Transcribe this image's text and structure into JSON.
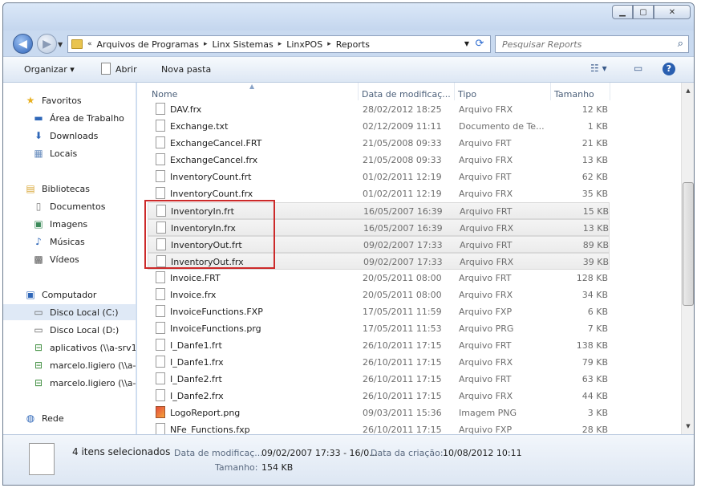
{
  "window": {
    "min_label": "▁",
    "max_label": "▢",
    "close_label": "✕"
  },
  "address": {
    "crumbs": [
      "Arquivos de Programas",
      "Linx Sistemas",
      "LinxPOS",
      "Reports"
    ],
    "prefix": "«",
    "separator": "▸",
    "search_placeholder": "Pesquisar Reports"
  },
  "toolbar": {
    "organize": "Organizar ▾",
    "open": "Abrir",
    "new_folder": "Nova pasta"
  },
  "sidebar": {
    "items": [
      {
        "label": "Favoritos",
        "icon": "star-icon",
        "indent": 0,
        "selected": false
      },
      {
        "label": "Área de Trabalho",
        "icon": "desktop-icon",
        "indent": 1,
        "selected": false
      },
      {
        "label": "Downloads",
        "icon": "downloads-icon",
        "indent": 1,
        "selected": false
      },
      {
        "label": "Locais",
        "icon": "places-icon",
        "indent": 1,
        "selected": false
      },
      {
        "label": "Bibliotecas",
        "icon": "library-icon",
        "indent": 0,
        "selected": false
      },
      {
        "label": "Documentos",
        "icon": "documents-icon",
        "indent": 1,
        "selected": false
      },
      {
        "label": "Imagens",
        "icon": "pictures-icon",
        "indent": 1,
        "selected": false
      },
      {
        "label": "Músicas",
        "icon": "music-icon",
        "indent": 1,
        "selected": false
      },
      {
        "label": "Vídeos",
        "icon": "video-icon",
        "indent": 1,
        "selected": false
      },
      {
        "label": "Computador",
        "icon": "computer-icon",
        "indent": 0,
        "selected": false
      },
      {
        "label": "Disco Local (C:)",
        "icon": "drive-icon",
        "indent": 1,
        "selected": true
      },
      {
        "label": "Disco Local (D:)",
        "icon": "drive-icon",
        "indent": 1,
        "selected": false
      },
      {
        "label": "aplicativos (\\\\a-srv1-",
        "icon": "network-drive-icon",
        "indent": 1,
        "selected": false
      },
      {
        "label": "marcelo.ligiero (\\\\a-",
        "icon": "network-drive-icon",
        "indent": 1,
        "selected": false
      },
      {
        "label": "marcelo.ligiero (\\\\a-",
        "icon": "network-drive-icon",
        "indent": 1,
        "selected": false
      },
      {
        "label": "Rede",
        "icon": "network-icon",
        "indent": 0,
        "selected": false
      }
    ]
  },
  "columns": {
    "name": "Nome",
    "date": "Data de modificaç...",
    "type": "Tipo",
    "size": "Tamanho"
  },
  "files": [
    {
      "name": "DAV.frx",
      "date": "28/02/2012 18:25",
      "type": "Arquivo FRX",
      "size": "12 KB",
      "selected": false,
      "icon": "file-icon"
    },
    {
      "name": "Exchange.txt",
      "date": "02/12/2009 11:11",
      "type": "Documento de Te...",
      "size": "1 KB",
      "selected": false,
      "icon": "text-file-icon"
    },
    {
      "name": "ExchangeCancel.FRT",
      "date": "21/05/2008 09:33",
      "type": "Arquivo FRT",
      "size": "21 KB",
      "selected": false,
      "icon": "file-icon"
    },
    {
      "name": "ExchangeCancel.frx",
      "date": "21/05/2008 09:33",
      "type": "Arquivo FRX",
      "size": "13 KB",
      "selected": false,
      "icon": "file-icon"
    },
    {
      "name": "InventoryCount.frt",
      "date": "01/02/2011 12:19",
      "type": "Arquivo FRT",
      "size": "62 KB",
      "selected": false,
      "icon": "file-icon"
    },
    {
      "name": "InventoryCount.frx",
      "date": "01/02/2011 12:19",
      "type": "Arquivo FRX",
      "size": "35 KB",
      "selected": false,
      "icon": "file-icon"
    },
    {
      "name": "InventoryIn.frt",
      "date": "16/05/2007 16:39",
      "type": "Arquivo FRT",
      "size": "15 KB",
      "selected": true,
      "icon": "file-icon"
    },
    {
      "name": "InventoryIn.frx",
      "date": "16/05/2007 16:39",
      "type": "Arquivo FRX",
      "size": "13 KB",
      "selected": true,
      "icon": "file-icon"
    },
    {
      "name": "InventoryOut.frt",
      "date": "09/02/2007 17:33",
      "type": "Arquivo FRT",
      "size": "89 KB",
      "selected": true,
      "icon": "file-icon"
    },
    {
      "name": "InventoryOut.frx",
      "date": "09/02/2007 17:33",
      "type": "Arquivo FRX",
      "size": "39 KB",
      "selected": true,
      "icon": "file-icon"
    },
    {
      "name": "Invoice.FRT",
      "date": "20/05/2011 08:00",
      "type": "Arquivo FRT",
      "size": "128 KB",
      "selected": false,
      "icon": "file-icon"
    },
    {
      "name": "Invoice.frx",
      "date": "20/05/2011 08:00",
      "type": "Arquivo FRX",
      "size": "34 KB",
      "selected": false,
      "icon": "file-icon"
    },
    {
      "name": "InvoiceFunctions.FXP",
      "date": "17/05/2011 11:59",
      "type": "Arquivo FXP",
      "size": "6 KB",
      "selected": false,
      "icon": "file-icon"
    },
    {
      "name": "InvoiceFunctions.prg",
      "date": "17/05/2011 11:53",
      "type": "Arquivo PRG",
      "size": "7 KB",
      "selected": false,
      "icon": "file-icon"
    },
    {
      "name": "I_Danfe1.frt",
      "date": "26/10/2011 17:15",
      "type": "Arquivo FRT",
      "size": "138 KB",
      "selected": false,
      "icon": "file-icon"
    },
    {
      "name": "I_Danfe1.frx",
      "date": "26/10/2011 17:15",
      "type": "Arquivo FRX",
      "size": "79 KB",
      "selected": false,
      "icon": "file-icon"
    },
    {
      "name": "I_Danfe2.frt",
      "date": "26/10/2011 17:15",
      "type": "Arquivo FRT",
      "size": "63 KB",
      "selected": false,
      "icon": "file-icon"
    },
    {
      "name": "I_Danfe2.frx",
      "date": "26/10/2011 17:15",
      "type": "Arquivo FRX",
      "size": "44 KB",
      "selected": false,
      "icon": "file-icon"
    },
    {
      "name": "LogoReport.png",
      "date": "09/03/2011 15:36",
      "type": "Imagem PNG",
      "size": "3 KB",
      "selected": false,
      "icon": "image-file-icon"
    },
    {
      "name": "NFe_Functions.fxp",
      "date": "26/10/2011 17:15",
      "type": "Arquivo FXP",
      "size": "28 KB",
      "selected": false,
      "icon": "file-icon"
    }
  ],
  "status": {
    "count": "4 itens selecionados",
    "modified_label": "Data de modificaç...",
    "modified_value": "09/02/2007 17:33 - 16/0...",
    "created_label": "Data da criação:",
    "created_value": "10/08/2012 10:11",
    "size_label": "Tamanho:",
    "size_value": "154 KB"
  },
  "colors": {
    "highlight": "#cc2a2a",
    "selection": "#ebebeb",
    "link_blue": "#2b6ad0"
  }
}
